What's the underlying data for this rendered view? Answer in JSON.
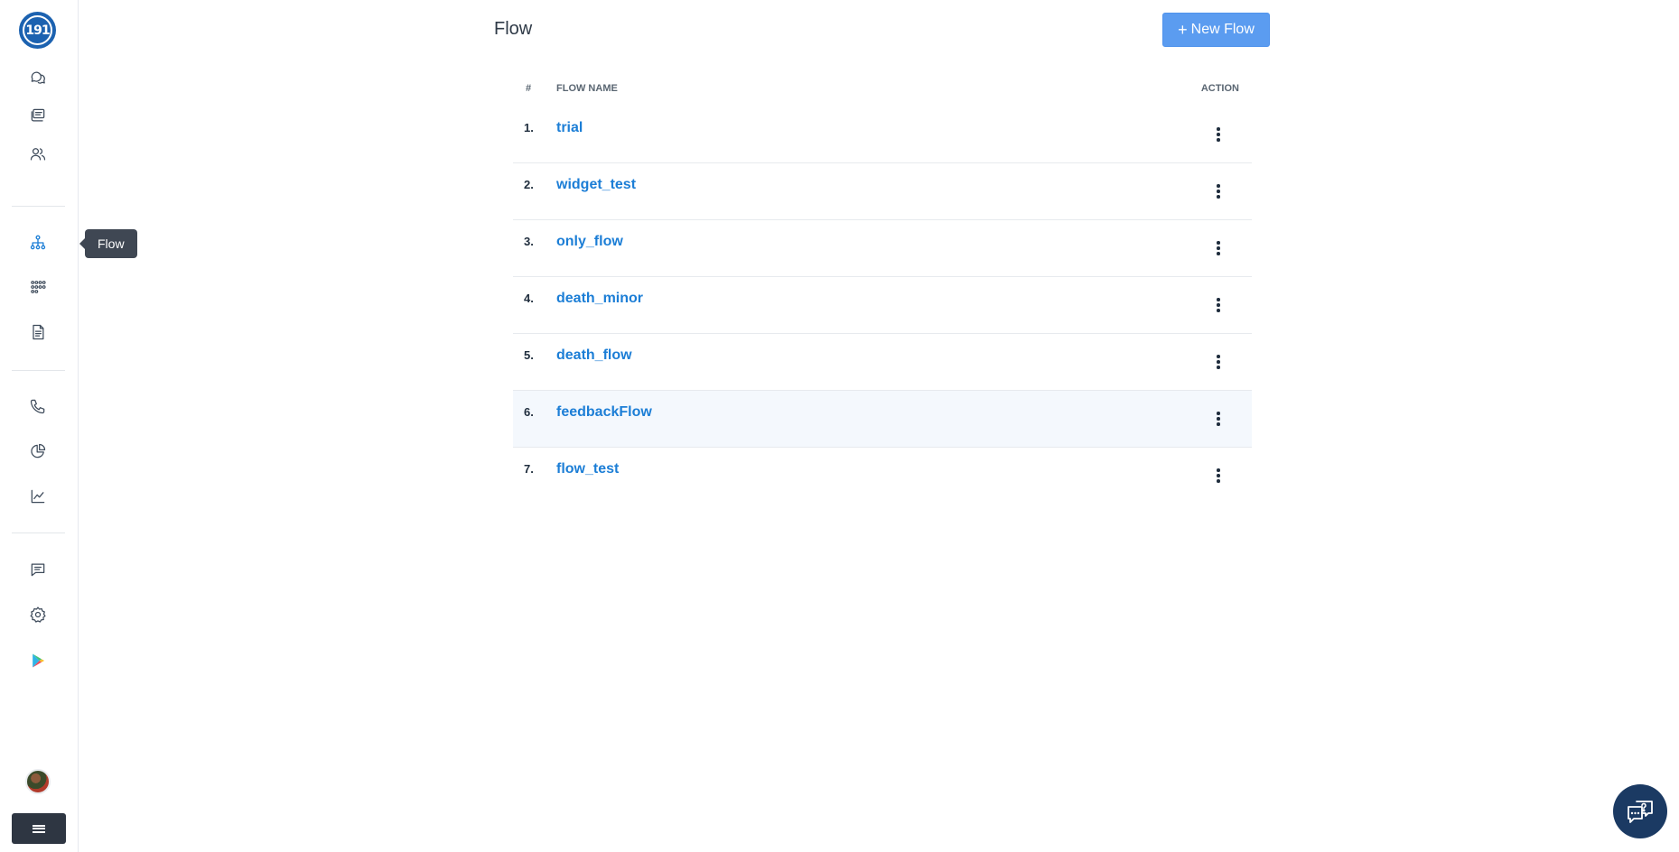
{
  "sidebar": {
    "logo_text": "191",
    "items": [
      {
        "name": "chats-icon"
      },
      {
        "name": "campaigns-icon"
      },
      {
        "name": "contacts-icon"
      },
      {
        "name": "flow-icon"
      },
      {
        "name": "apps-icon"
      },
      {
        "name": "templates-icon"
      },
      {
        "name": "phone-icon"
      },
      {
        "name": "reports-icon"
      },
      {
        "name": "analytics-icon"
      },
      {
        "name": "messages-icon"
      },
      {
        "name": "settings-icon"
      },
      {
        "name": "play-store-icon"
      }
    ],
    "tooltip": "Flow"
  },
  "header": {
    "title": "Flow",
    "new_button_label": "New Flow",
    "new_button_icon": "plus-icon"
  },
  "table": {
    "columns": {
      "num": "#",
      "name": "FLOW NAME",
      "action": "ACTION"
    },
    "rows": [
      {
        "num": "1.",
        "name": "trial"
      },
      {
        "num": "2.",
        "name": "widget_test"
      },
      {
        "num": "3.",
        "name": "only_flow"
      },
      {
        "num": "4.",
        "name": "death_minor"
      },
      {
        "num": "5.",
        "name": "death_flow"
      },
      {
        "num": "6.",
        "name": "feedbackFlow"
      },
      {
        "num": "7.",
        "name": "flow_test"
      }
    ]
  },
  "colors": {
    "accent": "#1c7ed6",
    "button": "#5b9cf0",
    "logo": "#1c62b0",
    "help_fab": "#1b3a63",
    "highlight_row": "#f4f8fd"
  }
}
